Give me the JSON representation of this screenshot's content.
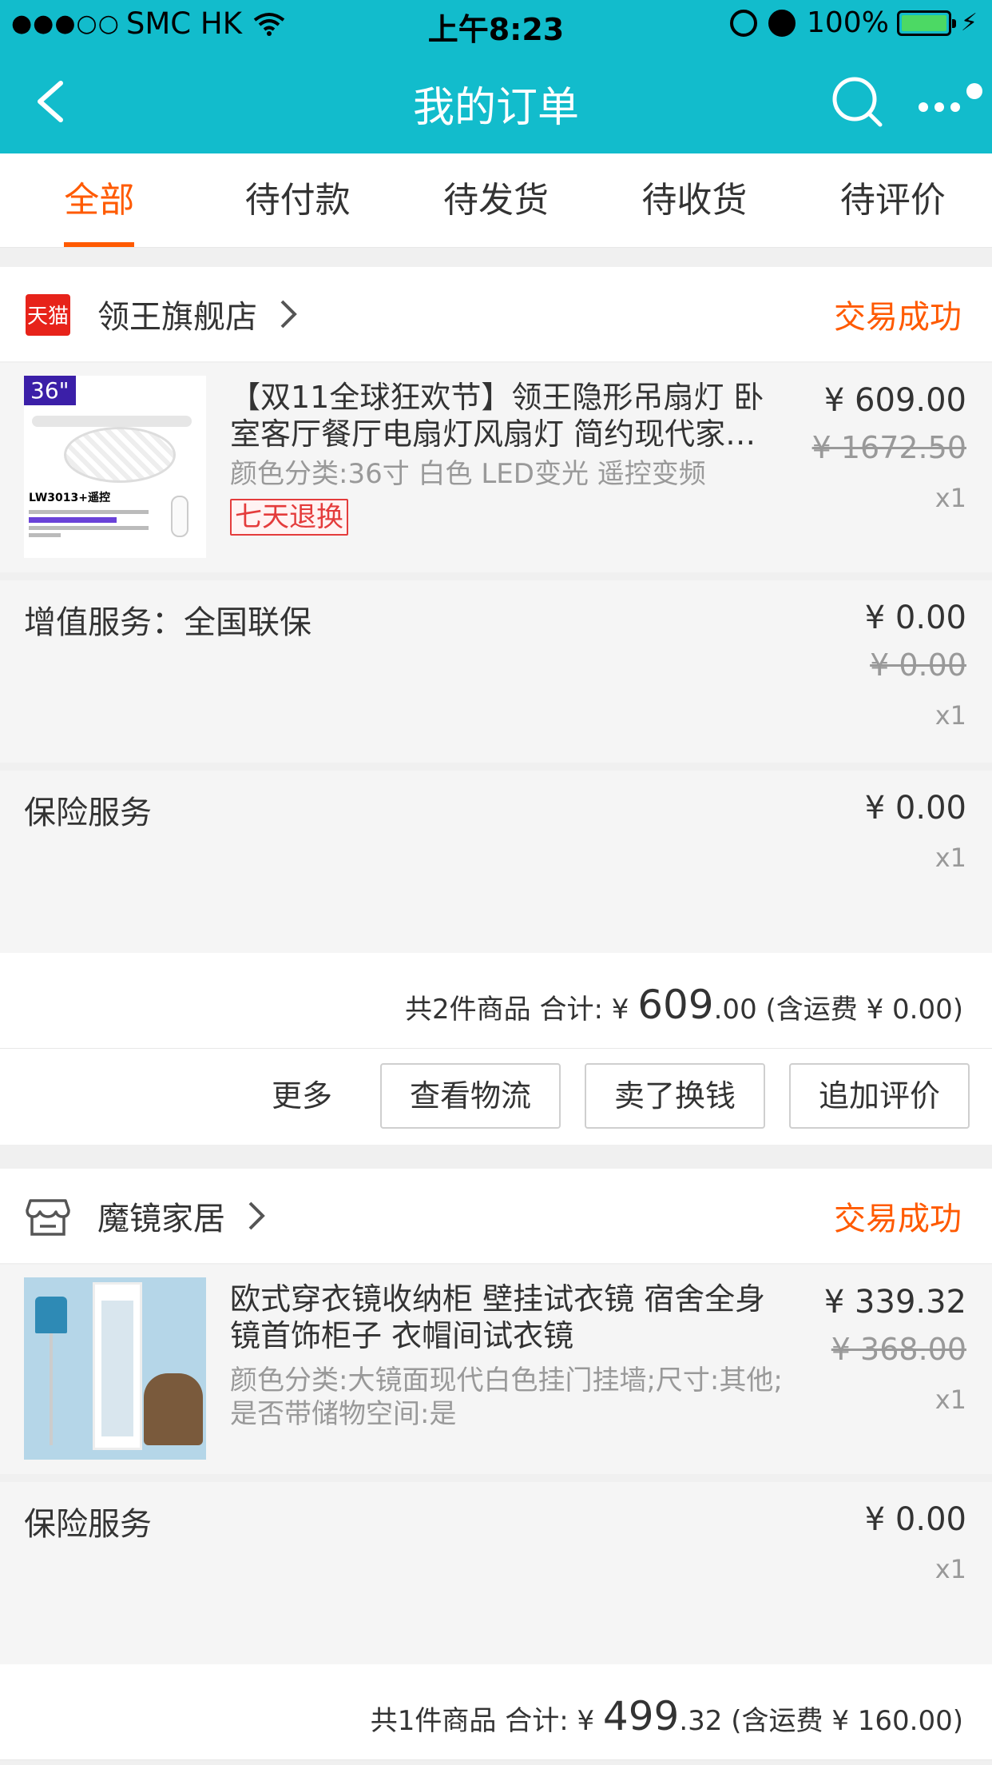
{
  "status_bar": {
    "carrier": "SMC HK",
    "time": "上午8:23",
    "battery": "100%"
  },
  "nav": {
    "title": "我的订单"
  },
  "tabs": [
    {
      "label": "全部"
    },
    {
      "label": "待付款"
    },
    {
      "label": "待发货"
    },
    {
      "label": "待收货"
    },
    {
      "label": "待评价"
    }
  ],
  "orders": [
    {
      "shop_name": "领王旗舰店",
      "shop_logo_text": "天猫",
      "status": "交易成功",
      "item": {
        "title": "【双11全球狂欢节】领王隐形吊扇灯 卧室客厅餐厅电扇灯风扇灯 简约现代家…",
        "sku": "颜色分类:36寸 白色 LED变光 遥控变频",
        "tag": "七天退换",
        "price": "¥ 609.00",
        "original_price": "¥ 1672.50",
        "qty": "x1",
        "thumb_badge": "36\"",
        "thumb_model": "LW3013+遥控"
      },
      "services": [
        {
          "label": "增值服务：全国联保",
          "price": "¥ 0.00",
          "original_price": "¥ 0.00",
          "qty": "x1"
        },
        {
          "label": "保险服务",
          "price": "¥ 0.00",
          "qty": "x1"
        }
      ],
      "summary": {
        "prefix": "共2件商品 合计: ¥ ",
        "amount_int": "609",
        "amount_dec": ".00",
        "shipping": " (含运费 ¥ 0.00)"
      },
      "actions": {
        "more": "更多",
        "logistics": "查看物流",
        "resell": "卖了换钱",
        "review": "追加评价"
      }
    },
    {
      "shop_name": "魔镜家居",
      "status": "交易成功",
      "item": {
        "title": "欧式穿衣镜收纳柜 壁挂试衣镜 宿舍全身镜首饰柜子 衣帽间试衣镜",
        "sku": "颜色分类:大镜面现代白色挂门挂墙;尺寸:其他;是否带储物空间:是",
        "price": "¥ 339.32",
        "original_price": "¥ 368.00",
        "qty": "x1"
      },
      "services": [
        {
          "label": "保险服务",
          "price": "¥ 0.00",
          "qty": "x1"
        }
      ],
      "summary": {
        "prefix": "共1件商品 合计: ¥ ",
        "amount_int": "499",
        "amount_dec": ".32",
        "shipping": " (含运费 ¥ 160.00)"
      }
    }
  ],
  "colors": {
    "header": "#12bccc",
    "accent": "#ff5a00"
  }
}
